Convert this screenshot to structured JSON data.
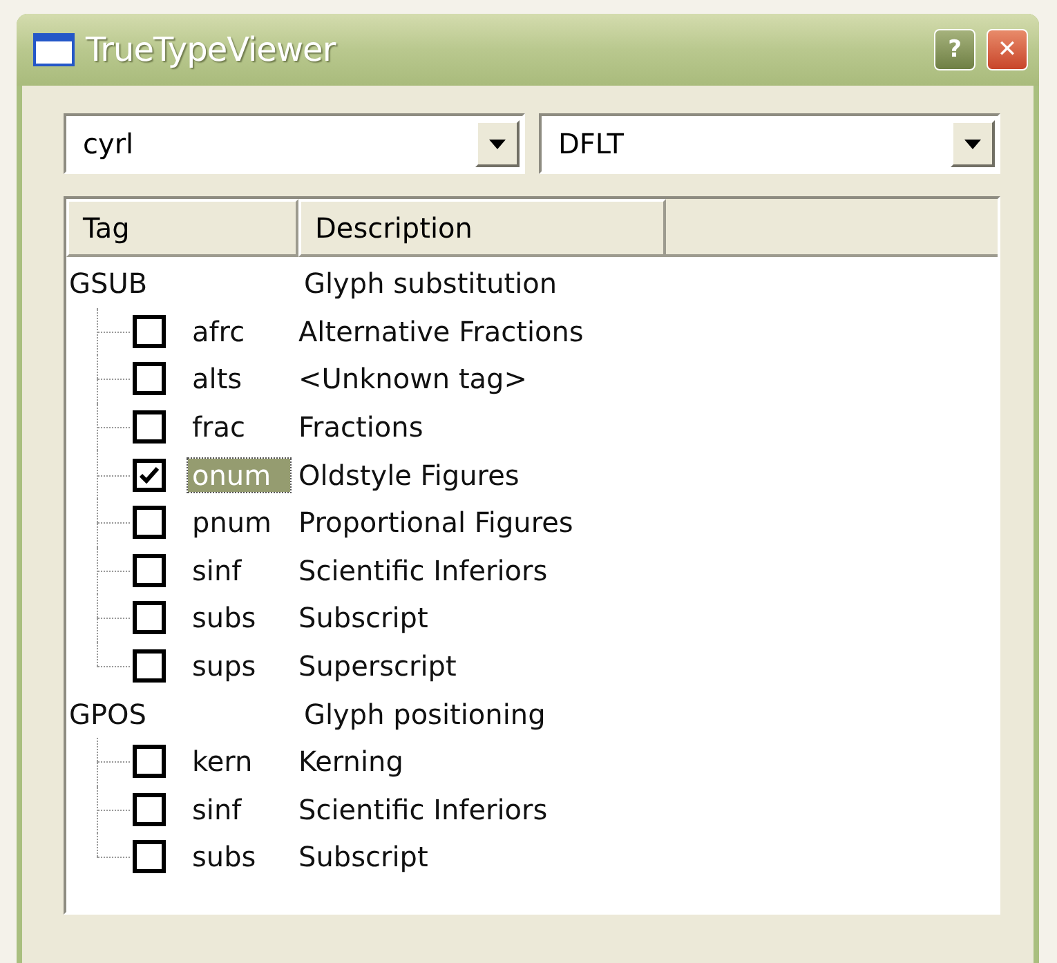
{
  "window": {
    "title": "TrueTypeViewer"
  },
  "title_buttons": [
    {
      "kind": "help",
      "label": "?"
    },
    {
      "kind": "close",
      "label": "✕"
    }
  ],
  "selects": [
    {
      "value": "cyrl"
    },
    {
      "value": "DFLT"
    }
  ],
  "columns": [
    "Tag",
    "Description"
  ],
  "groups": [
    {
      "tag": "GSUB",
      "description": "Glyph substitution",
      "children": [
        {
          "tag": "afrc",
          "description": "Alternative Fractions",
          "checked": false,
          "selected": false
        },
        {
          "tag": "alts",
          "description": "<Unknown tag>",
          "checked": false,
          "selected": false
        },
        {
          "tag": "frac",
          "description": "Fractions",
          "checked": false,
          "selected": false
        },
        {
          "tag": "onum",
          "description": "Oldstyle Figures",
          "checked": true,
          "selected": true
        },
        {
          "tag": "pnum",
          "description": "Proportional Figures",
          "checked": false,
          "selected": false
        },
        {
          "tag": "sinf",
          "description": "Scientific Inferiors",
          "checked": false,
          "selected": false
        },
        {
          "tag": "subs",
          "description": "Subscript",
          "checked": false,
          "selected": false
        },
        {
          "tag": "sups",
          "description": "Superscript",
          "checked": false,
          "selected": false
        }
      ]
    },
    {
      "tag": "GPOS",
      "description": "Glyph positioning",
      "children": [
        {
          "tag": "kern",
          "description": "Kerning",
          "checked": false,
          "selected": false
        },
        {
          "tag": "sinf",
          "description": "Scientific Inferiors",
          "checked": false,
          "selected": false
        },
        {
          "tag": "subs",
          "description": "Subscript",
          "checked": false,
          "selected": false
        }
      ]
    }
  ]
}
